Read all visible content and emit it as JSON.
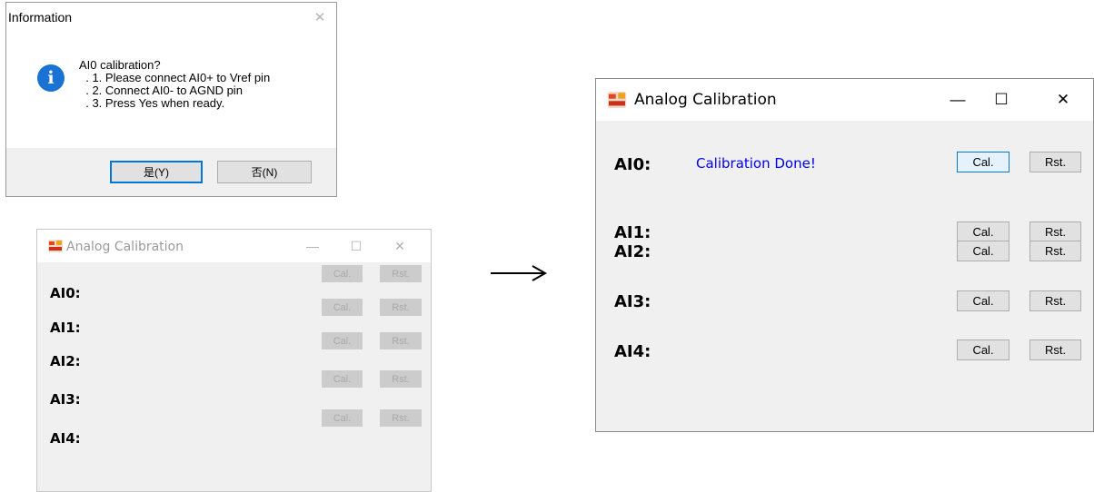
{
  "info_dialog": {
    "title": "Information",
    "close_symbol": "✕",
    "icon": "info-icon",
    "icon_glyph": "i",
    "message_lines": [
      "AI0 calibration?",
      "  . 1. Please connect AI0+ to Vref pin",
      "  . 2. Connect AI0- to AGND pin",
      "  . 3. Press Yes when ready."
    ],
    "yes_label": "是(Y)",
    "no_label": "否(N)"
  },
  "before_window": {
    "title": "Analog Calibration",
    "controls": {
      "minimize": "—",
      "maximize": "☐",
      "close": "✕"
    },
    "rows": [
      {
        "label": "AI0:",
        "cal": "Cal.",
        "rst": "Rst."
      },
      {
        "label": "AI1:",
        "cal": "Cal.",
        "rst": "Rst."
      },
      {
        "label": "AI2:",
        "cal": "Cal.",
        "rst": "Rst."
      },
      {
        "label": "AI3:",
        "cal": "Cal.",
        "rst": "Rst."
      },
      {
        "label": "AI4:",
        "cal": "Cal.",
        "rst": "Rst."
      }
    ]
  },
  "arrow": "right-arrow",
  "after_window": {
    "title": "Analog Calibration",
    "controls": {
      "minimize": "—",
      "maximize": "☐",
      "close": "✕"
    },
    "status_text": "Calibration Done!",
    "rows": [
      {
        "label": "AI0:",
        "cal": "Cal.",
        "rst": "Rst."
      },
      {
        "label": "AI1:",
        "cal": "Cal.",
        "rst": "Rst."
      },
      {
        "label": "AI2:",
        "cal": "Cal.",
        "rst": "Rst."
      },
      {
        "label": "AI3:",
        "cal": "Cal.",
        "rst": "Rst."
      },
      {
        "label": "AI4:",
        "cal": "Cal.",
        "rst": "Rst."
      }
    ]
  },
  "colors": {
    "status_text": "#0000ee",
    "dialog_default_button_border": "#0078d7",
    "info_icon": "#1a73d4",
    "disabled_text": "#a8a8a8"
  }
}
